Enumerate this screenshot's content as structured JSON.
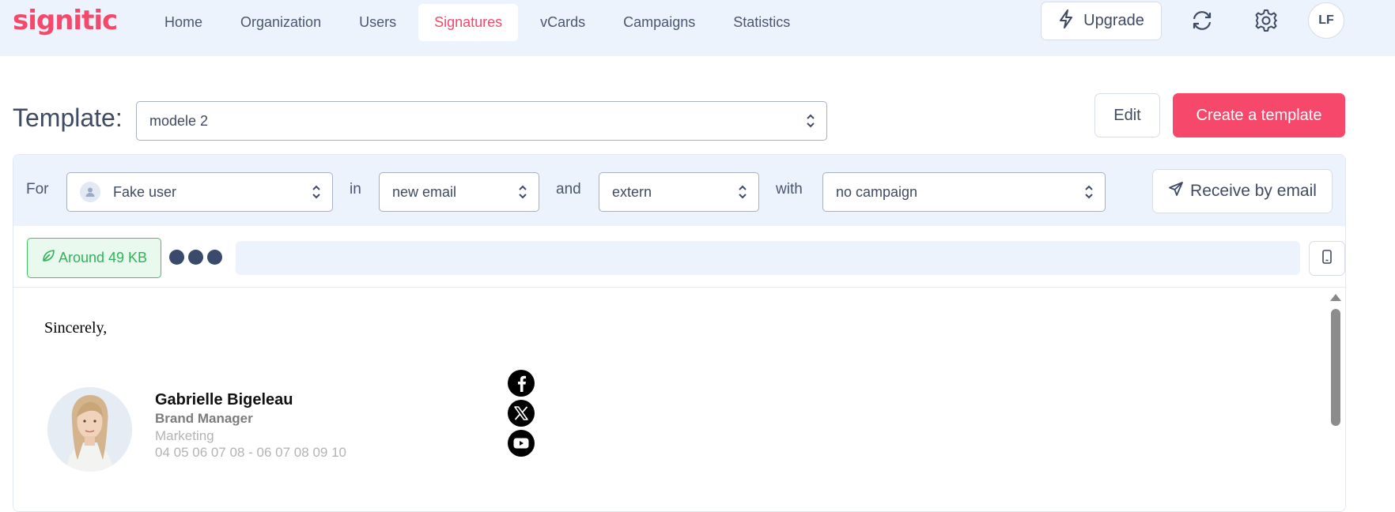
{
  "app": {
    "logo_text": "signitic",
    "brand_color": "#f5486b"
  },
  "nav": {
    "items": [
      {
        "label": "Home",
        "active": false
      },
      {
        "label": "Organization",
        "active": false
      },
      {
        "label": "Users",
        "active": false
      },
      {
        "label": "Signatures",
        "active": true
      },
      {
        "label": "vCards",
        "active": false
      },
      {
        "label": "Campaigns",
        "active": false
      },
      {
        "label": "Statistics",
        "active": false
      }
    ],
    "upgrade_label": "Upgrade",
    "avatar_initials": "LF"
  },
  "template": {
    "label": "Template:",
    "selected": "modele 2",
    "edit_label": "Edit",
    "create_label": "Create a template"
  },
  "filters": {
    "for_word": "For",
    "user_value": "Fake user",
    "in_word": "in",
    "email_type": "new email",
    "and_word": "and",
    "audience": "extern",
    "with_word": "with",
    "campaign": "no campaign",
    "receive_label": "Receive by email"
  },
  "toolbar": {
    "size_label": "Around 49 KB",
    "size_color": "#2fb35a"
  },
  "preview": {
    "greeting": "Sincerely,",
    "signature": {
      "name": "Gabrielle Bigeleau",
      "title": "Brand Manager",
      "department": "Marketing",
      "phones": "04 05 06 07 08 - 06 07 08 09 10"
    },
    "socials": [
      "facebook-icon",
      "x-icon",
      "youtube-icon"
    ]
  }
}
